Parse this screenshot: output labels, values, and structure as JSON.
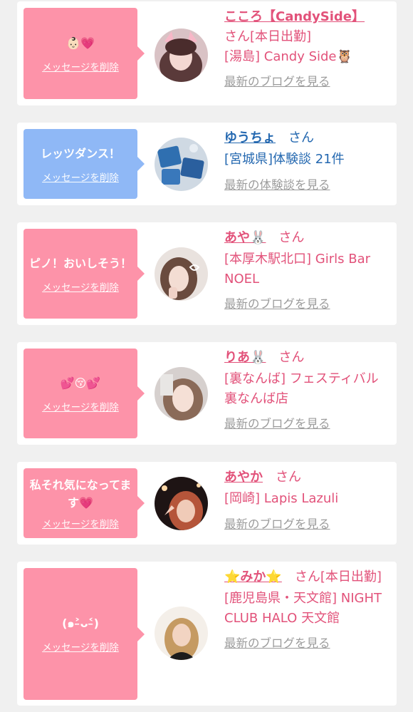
{
  "colors": {
    "pink": "#fd93a9",
    "blue": "#8fb8f6",
    "pink_text": "#e2527a",
    "blue_text": "#2468b0",
    "link": "#9c9c9c"
  },
  "items": [
    {
      "bubble_msg": "👶🏻💗",
      "delete_label": "メッセージを削除",
      "name": "こころ【CandySide】",
      "san": "さん[本日出勤]",
      "detail": "[湯島] Candy Side🦉",
      "link": "最新のブログを見る",
      "bubble_color": "pink"
    },
    {
      "bubble_msg": "レッツダンス！",
      "delete_label": "メッセージを削除",
      "name": "ゆうちょ",
      "san": "さん",
      "detail": "[宮城県]体験談 21件",
      "link": "最新の体験談を見る",
      "bubble_color": "blue"
    },
    {
      "bubble_msg": "ピノ！おいしそう！",
      "delete_label": "メッセージを削除",
      "name": "あや🐰",
      "san": "さん",
      "detail": "[本厚木駅北口] Girls Bar NOEL",
      "link": "最新のブログを見る",
      "bubble_color": "pink"
    },
    {
      "bubble_msg": "💕😚💕",
      "delete_label": "メッセージを削除",
      "name": "りあ🐰",
      "san": "さん",
      "detail": "[裏なんば] フェスティバル 裏なんば店",
      "link": "最新のブログを見る",
      "bubble_color": "pink"
    },
    {
      "bubble_msg": "私それ気になってます💗",
      "delete_label": "メッセージを削除",
      "name": "あやか",
      "san": "さん",
      "detail": "[岡崎] Lapis Lazuli",
      "link": "最新のブログを見る",
      "bubble_color": "pink"
    },
    {
      "bubble_msg": "(๑˃̵ᴗ˂̵)",
      "delete_label": "メッセージを削除",
      "name": "⭐みか⭐",
      "san": "さん[本日出勤]",
      "detail": "[鹿児島県・天文館] NIGHT CLUB HALO 天文館",
      "link": "最新のブログを見る",
      "bubble_color": "pink"
    }
  ]
}
